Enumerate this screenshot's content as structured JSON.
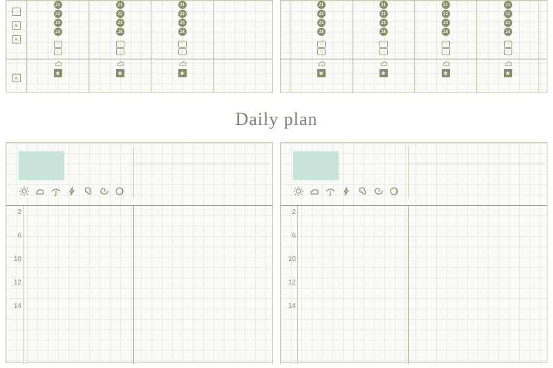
{
  "heading": "Daily plan",
  "top": {
    "numbers": [
      "21",
      "22",
      "23",
      "24"
    ],
    "star": "★"
  },
  "daily": {
    "time_labels": [
      "2",
      "6",
      "10",
      "12",
      "14"
    ]
  },
  "weather_icons": [
    "sun",
    "cloud",
    "umbrella",
    "lightning",
    "wind",
    "spiral",
    "moon"
  ]
}
